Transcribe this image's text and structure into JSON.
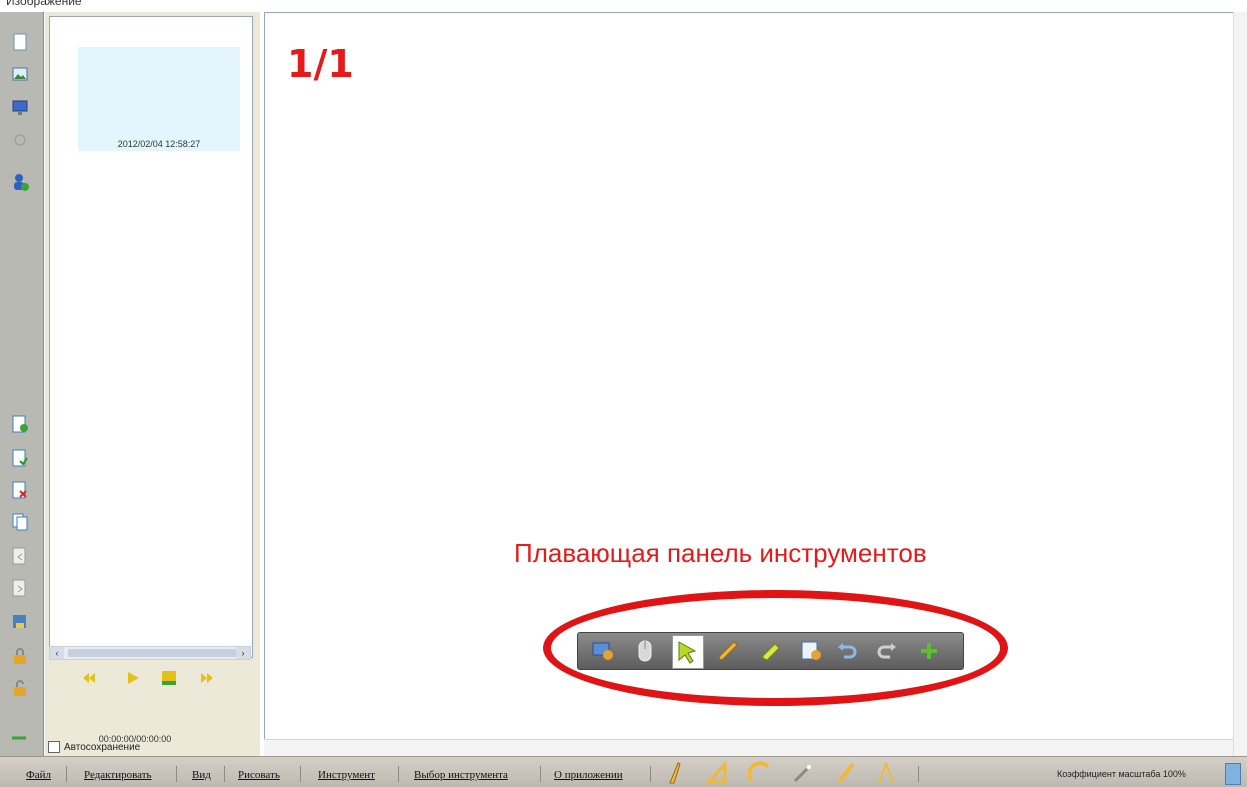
{
  "window": {
    "title_fragment": "Изображение"
  },
  "left_toolbar": {
    "icons": [
      "new-page-icon",
      "image-icon",
      "screen-icon",
      "disabled-icon",
      "user-icon",
      "add-page-icon",
      "duplicate-page-icon",
      "delete-page-icon",
      "copy-page-icon",
      "prev-page-icon",
      "next-page-icon",
      "save-icon",
      "lock-icon",
      "unlock-icon",
      "arrow-icon"
    ]
  },
  "thumbnails": {
    "items": [
      {
        "timestamp": "2012/02/04 12:58:27"
      }
    ]
  },
  "player": {
    "time": "00:00:00/00:00:00"
  },
  "autosave": {
    "label": "Автосохранение",
    "checked": false
  },
  "canvas": {
    "page_number": "1/1",
    "annotation": "Плавающая панель инструментов"
  },
  "floating_toolbar": {
    "buttons": [
      "screen-capture-icon",
      "mouse-icon",
      "select-arrow-icon",
      "pen-icon",
      "highlighter-icon",
      "eraser-icon",
      "undo-icon",
      "redo-icon",
      "add-icon"
    ],
    "active": "select-arrow-icon"
  },
  "menu": {
    "items": [
      "Файл",
      "Редактировать",
      "Вид",
      "Рисовать",
      "Инструмент",
      "Выбор инструмента",
      "О приложении"
    ]
  },
  "status": {
    "zoom": "Коэффициент масштаба 100%"
  },
  "colors": {
    "accent_red": "#e51b1b",
    "thumb_bg": "#e3f6fd",
    "panel_bg": "#ece9d8"
  }
}
